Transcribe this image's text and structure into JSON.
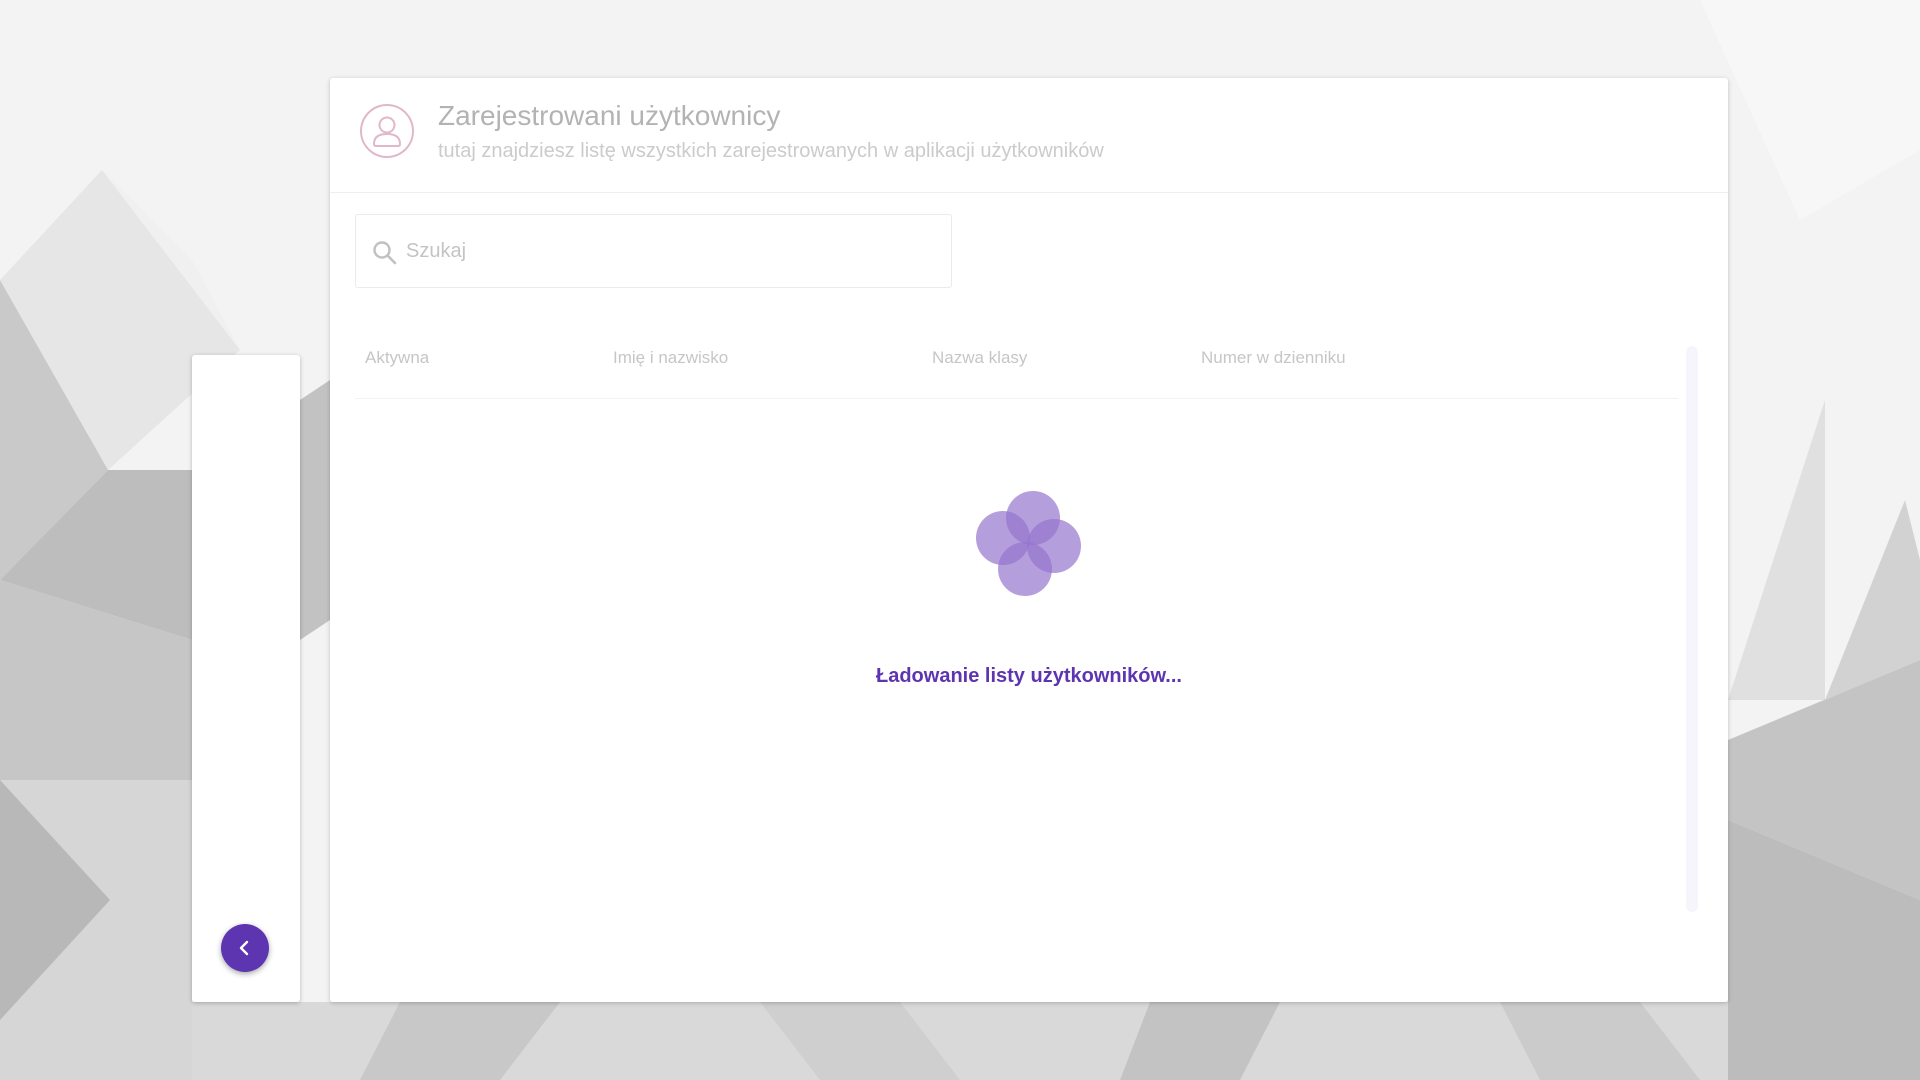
{
  "header": {
    "title": "Zarejestrowani użytkownicy",
    "subtitle": "tutaj znajdziesz listę wszystkich zarejestrowanych w aplikacji użytkowników",
    "icon": "user-icon"
  },
  "search": {
    "placeholder": "Szukaj",
    "value": "",
    "icon": "search-icon"
  },
  "table": {
    "columns": [
      "Aktywna",
      "Imię i nazwisko",
      "Nazwa klasy",
      "Numer w dzienniku"
    ]
  },
  "loading": {
    "message": "Ładowanie listy użytkowników...",
    "icon": "loading-spinner-icon"
  },
  "sidebar": {
    "collapse_icon": "chevron-left-icon"
  },
  "colors": {
    "accent": "#5e35b1",
    "spinner": "#9575cd",
    "user_icon": "#e1b8ca",
    "title": "#b3b3b3"
  }
}
